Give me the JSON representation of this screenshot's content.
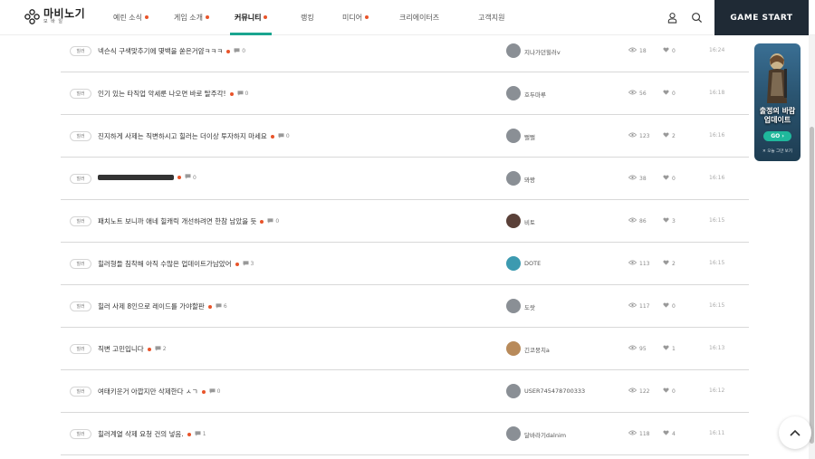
{
  "header": {
    "logo_title": "마비노기",
    "logo_sub": "모 바 일",
    "nav": [
      {
        "label": "예린 소식",
        "dot": true
      },
      {
        "label": "게임 소개",
        "dot": true
      },
      {
        "label": "커뮤니티",
        "dot": true,
        "active": true
      },
      {
        "label": "랭킹",
        "dot": false
      },
      {
        "label": "미디어",
        "dot": true
      },
      {
        "label": "크리에이터즈",
        "dot": false
      },
      {
        "label": "고객지원",
        "dot": false
      }
    ],
    "game_start": "GAME START"
  },
  "posts": [
    {
      "tag": "힐러",
      "title": "넥슨식 구색맞추기에 몇백을 쏟은거얌ㅋㅋㅋ",
      "comments": "0",
      "author": "지나가던힐러v",
      "views": "18",
      "likes": "0",
      "time": "16:24"
    },
    {
      "tag": "힐러",
      "title": "인기 있는 타직업 악세룬 나오면 바로 탈주각!",
      "comments": "0",
      "author": "호두마루",
      "views": "56",
      "likes": "0",
      "time": "16:18"
    },
    {
      "tag": "힐러",
      "title": "진지하게 사제는 직변하시고 힐러는 더이상 투자하지 마세요",
      "comments": "0",
      "author": "뻘뻘",
      "views": "123",
      "likes": "2",
      "time": "16:16"
    },
    {
      "tag": "힐러",
      "title": "",
      "comments": "0",
      "author": "뫄뫙",
      "views": "38",
      "likes": "0",
      "time": "16:16"
    },
    {
      "tag": "힐러",
      "title": "패치노트 보니까 애네 힐캐릭 개선하려면 한참 남았을 듯",
      "comments": "0",
      "author": "비토",
      "views": "86",
      "likes": "3",
      "time": "16:15"
    },
    {
      "tag": "힐러",
      "title": "힐러형들 침착해 아직 수많은 업데이트가남았어",
      "comments": "3",
      "author": "DOTE",
      "views": "113",
      "likes": "2",
      "time": "16:15"
    },
    {
      "tag": "힐러",
      "title": "힐러 사제 8인으로 레이드를 가야할판",
      "comments": "6",
      "author": "도랏",
      "views": "117",
      "likes": "0",
      "time": "16:15"
    },
    {
      "tag": "힐러",
      "title": "직변 고민입니다",
      "comments": "2",
      "author": "긴코뭉치a",
      "views": "95",
      "likes": "1",
      "time": "16:13"
    },
    {
      "tag": "힐러",
      "title": "여태키운거 아깝지만 삭제한다 ㅅㄱ",
      "comments": "0",
      "author": "USER745478700333",
      "views": "122",
      "likes": "0",
      "time": "16:12"
    },
    {
      "tag": "힐러",
      "title": "힐러계열 삭제 요청 건의 넣음.",
      "comments": "1",
      "author": "달바라기dalnim",
      "views": "118",
      "likes": "4",
      "time": "16:11"
    }
  ],
  "ad": {
    "title_line1": "출정의 바람",
    "title_line2": "업데이트",
    "go": "GO",
    "close": "✕ 오늘 그만 보기"
  },
  "colors": {
    "accent": "#1aa58f",
    "dot": "#e8542a",
    "game_start_bg": "#1f2a35"
  }
}
